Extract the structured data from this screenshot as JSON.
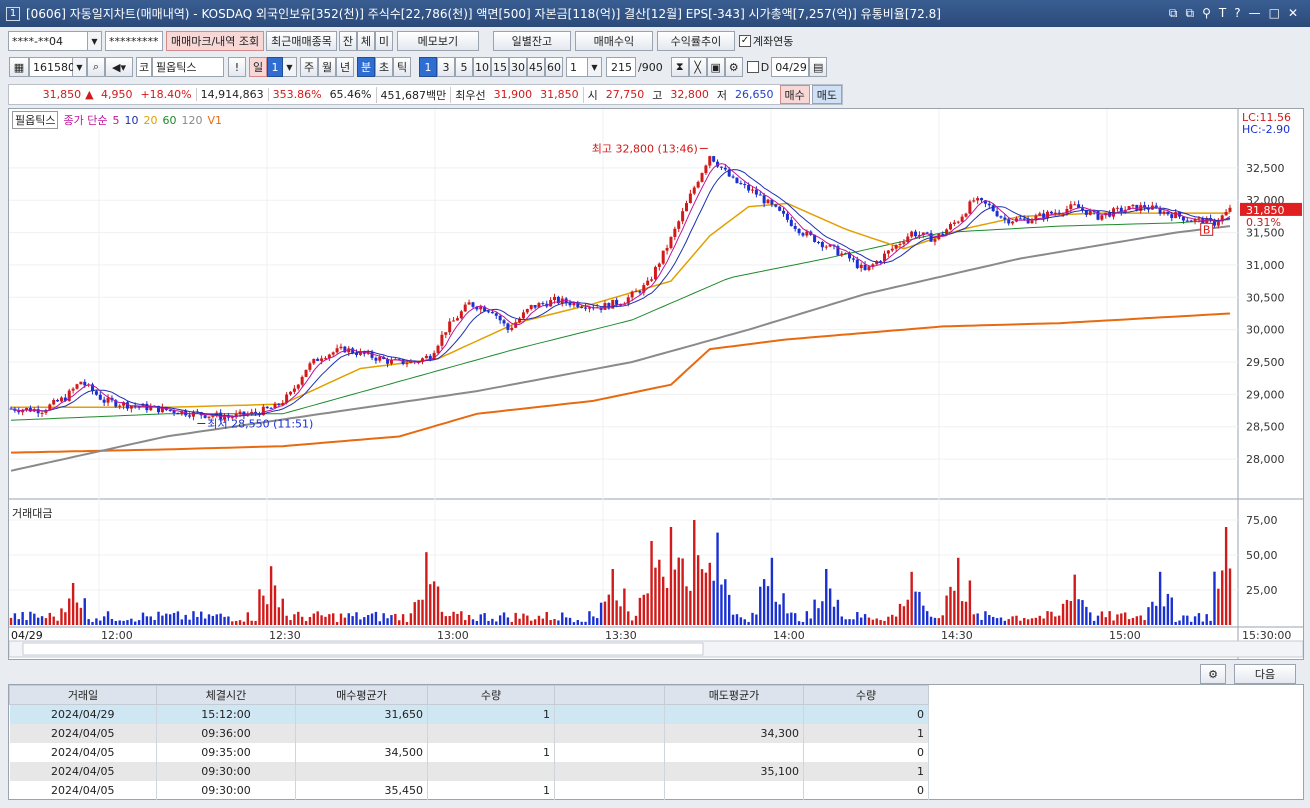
{
  "titlebar": {
    "window_number": "1",
    "title": "[0606] 자동일지차트(매매내역) - KOSDAQ 외국인보유[352(천)] 주식수[22,786(천)] 액면[500] 자본금[118(억)] 결산[12월] EPS[-343] 시가총액[7,257(억)] 유통비율[72.8]",
    "icons": [
      "layout-icon",
      "restore-icon",
      "pin-icon",
      "text-icon",
      "help-icon",
      "minimize-icon",
      "maximize-icon",
      "close-icon"
    ],
    "icon_glyphs": [
      "⧉",
      "⧉",
      "⚲",
      "T",
      "?",
      "—",
      "□",
      "✕"
    ]
  },
  "toolbar1": {
    "account": "****-**04",
    "password": "*********",
    "btn_mark": "매매마크/내역 조회",
    "btn_recent": "최근매매종목",
    "btn_jan": "잔",
    "btn_che": "체",
    "btn_mi": "미",
    "btn_memo": "메모보기",
    "btn_daily": "일별잔고",
    "btn_profit": "매매수익",
    "btn_rate": "수익률추이",
    "account_link_label": "계좌연동",
    "account_link_checked": true
  },
  "toolbar2": {
    "code": "161580",
    "market": "코",
    "stock_name": "필옵틱스",
    "period_tabs": [
      "일",
      "1",
      "주",
      "월",
      "년",
      "분",
      "초",
      "틱"
    ],
    "active_period": "분",
    "intervals": [
      "1",
      "3",
      "5",
      "10",
      "15",
      "30",
      "45",
      "60"
    ],
    "active_interval": "1",
    "interval_value": "1",
    "count": "215",
    "count_total": "/900",
    "date_label": "D",
    "date_value": "04/29"
  },
  "quote": {
    "price": "31,850",
    "change_icon": "▲",
    "change": "4,950",
    "change_pct": "+18.40%",
    "volume": "14,914,863",
    "vol_ratio": "353.86%",
    "turnover": "65.46%",
    "amount": "451,687백만",
    "best_label": "최우선",
    "best_sell": "31,900",
    "best_buy": "31,850",
    "open_label": "시",
    "open": "27,750",
    "high_label": "고",
    "high": "32,800",
    "low_label": "저",
    "low": "26,650",
    "buy_btn": "매수",
    "sell_btn": "매도"
  },
  "chart_legend": {
    "name": "필옵틱스",
    "ma_label": "종가 단순",
    "ma_periods": [
      "5",
      "10",
      "20",
      "60",
      "120"
    ],
    "v1": "V1",
    "vol_name": "거래대금",
    "colors": {
      "ma5": "#c0149b",
      "ma10": "#1f2fb0",
      "ma20": "#e2a000",
      "ma60": "#1e8a2b",
      "ma120": "#8a8a8a",
      "v1": "#e86a10",
      "up": "#d11a1a",
      "down": "#1a30d1"
    }
  },
  "chart_data": {
    "type": "candlestick",
    "date": "04/29",
    "x_ticks": [
      "12:00",
      "12:30",
      "13:00",
      "13:30",
      "14:00",
      "14:30",
      "15:00"
    ],
    "x_end_label": "15:30:00",
    "y_ticks": [
      "32,500",
      "32,000",
      "31,500",
      "31,000",
      "30,500",
      "30,000",
      "29,500",
      "29,000",
      "28,500",
      "28,000"
    ],
    "ylim": [
      27600,
      33100
    ],
    "high_annotation": "최고 32,800 (13:46)",
    "low_annotation": "최저 28,550 (11:51)",
    "lc_label": "LC:11.56",
    "hc_label": "HC:-2.90",
    "current_price": "31,850",
    "current_pct": "0.31%",
    "buy_marker": "B",
    "vol_ticks": [
      "75,00",
      "50,00",
      "25,00"
    ],
    "vol_ylim": [
      0,
      80
    ],
    "price_path": [
      [
        0,
        28780
      ],
      [
        8,
        28760
      ],
      [
        14,
        28950
      ],
      [
        18,
        29200
      ],
      [
        24,
        28900
      ],
      [
        32,
        28820
      ],
      [
        40,
        28760
      ],
      [
        48,
        28700
      ],
      [
        56,
        28650
      ],
      [
        62,
        28700
      ],
      [
        68,
        28800
      ],
      [
        72,
        29000
      ],
      [
        76,
        29400
      ],
      [
        80,
        29600
      ],
      [
        86,
        29700
      ],
      [
        92,
        29600
      ],
      [
        98,
        29500
      ],
      [
        104,
        29500
      ],
      [
        108,
        29600
      ],
      [
        112,
        30000
      ],
      [
        118,
        30400
      ],
      [
        124,
        30300
      ],
      [
        128,
        30000
      ],
      [
        134,
        30350
      ],
      [
        140,
        30450
      ],
      [
        146,
        30400
      ],
      [
        152,
        30350
      ],
      [
        158,
        30450
      ],
      [
        164,
        30700
      ],
      [
        170,
        31400
      ],
      [
        176,
        32200
      ],
      [
        180,
        32700
      ],
      [
        186,
        32300
      ],
      [
        192,
        32100
      ],
      [
        198,
        31800
      ],
      [
        204,
        31500
      ],
      [
        210,
        31300
      ],
      [
        216,
        31100
      ],
      [
        220,
        30900
      ],
      [
        226,
        31200
      ],
      [
        232,
        31500
      ],
      [
        238,
        31400
      ],
      [
        244,
        31700
      ],
      [
        248,
        32000
      ],
      [
        252,
        31900
      ],
      [
        256,
        31700
      ],
      [
        262,
        31700
      ],
      [
        268,
        31800
      ],
      [
        274,
        31900
      ],
      [
        280,
        31750
      ],
      [
        286,
        31850
      ],
      [
        292,
        31900
      ],
      [
        298,
        31800
      ],
      [
        304,
        31700
      ],
      [
        310,
        31650
      ],
      [
        314,
        31850
      ]
    ],
    "ma20_path": [
      [
        0,
        28800
      ],
      [
        40,
        28800
      ],
      [
        70,
        28850
      ],
      [
        90,
        29400
      ],
      [
        110,
        29550
      ],
      [
        130,
        30100
      ],
      [
        150,
        30400
      ],
      [
        170,
        30750
      ],
      [
        180,
        31450
      ],
      [
        190,
        31900
      ],
      [
        200,
        31950
      ],
      [
        215,
        31550
      ],
      [
        230,
        31250
      ],
      [
        245,
        31550
      ],
      [
        260,
        31750
      ],
      [
        280,
        31800
      ],
      [
        300,
        31800
      ],
      [
        314,
        31800
      ]
    ],
    "ma60_path": [
      [
        0,
        28600
      ],
      [
        40,
        28700
      ],
      [
        70,
        28700
      ],
      [
        100,
        29200
      ],
      [
        130,
        29700
      ],
      [
        160,
        30150
      ],
      [
        185,
        30800
      ],
      [
        210,
        31100
      ],
      [
        240,
        31500
      ],
      [
        270,
        31600
      ],
      [
        300,
        31650
      ],
      [
        314,
        31700
      ]
    ],
    "ma120_path": [
      [
        0,
        27820
      ],
      [
        40,
        28350
      ],
      [
        80,
        28700
      ],
      [
        120,
        29050
      ],
      [
        160,
        29500
      ],
      [
        190,
        30000
      ],
      [
        220,
        30550
      ],
      [
        260,
        31100
      ],
      [
        300,
        31500
      ],
      [
        314,
        31600
      ]
    ],
    "v1_path": [
      [
        0,
        28100
      ],
      [
        40,
        28150
      ],
      [
        70,
        28200
      ],
      [
        100,
        28350
      ],
      [
        120,
        28700
      ],
      [
        150,
        28900
      ],
      [
        170,
        29150
      ],
      [
        180,
        29700
      ],
      [
        200,
        29850
      ],
      [
        220,
        29950
      ],
      [
        240,
        30050
      ],
      [
        270,
        30100
      ],
      [
        314,
        30250
      ]
    ],
    "volume_peaks": [
      [
        16,
        30
      ],
      [
        67,
        42
      ],
      [
        107,
        52
      ],
      [
        155,
        40
      ],
      [
        165,
        60
      ],
      [
        170,
        70
      ],
      [
        176,
        75
      ],
      [
        182,
        66
      ],
      [
        196,
        48
      ],
      [
        210,
        40
      ],
      [
        232,
        38
      ],
      [
        244,
        48
      ],
      [
        274,
        36
      ],
      [
        296,
        38
      ],
      [
        313,
        70
      ]
    ]
  },
  "trades_table": {
    "headers": [
      "거래일",
      "체결시간",
      "매수평균가",
      "수량",
      "",
      "매도평균가",
      "수량"
    ],
    "rows": [
      {
        "date": "2024/04/29",
        "time": "15:12:00",
        "buy_avg": "31,650",
        "buy_qty": "1",
        "sell_avg": "",
        "sell_qty": "0"
      },
      {
        "date": "2024/04/05",
        "time": "09:36:00",
        "buy_avg": "",
        "buy_qty": "",
        "sell_avg": "34,300",
        "sell_qty": "1"
      },
      {
        "date": "2024/04/05",
        "time": "09:35:00",
        "buy_avg": "34,500",
        "buy_qty": "1",
        "sell_avg": "",
        "sell_qty": "0"
      },
      {
        "date": "2024/04/05",
        "time": "09:30:00",
        "buy_avg": "",
        "buy_qty": "",
        "sell_avg": "35,100",
        "sell_qty": "1"
      },
      {
        "date": "2024/04/05",
        "time": "09:30:00",
        "buy_avg": "35,450",
        "buy_qty": "1",
        "sell_avg": "",
        "sell_qty": "0"
      }
    ]
  },
  "footer": {
    "next_btn": "다음",
    "settings_icon": "gear-icon"
  }
}
